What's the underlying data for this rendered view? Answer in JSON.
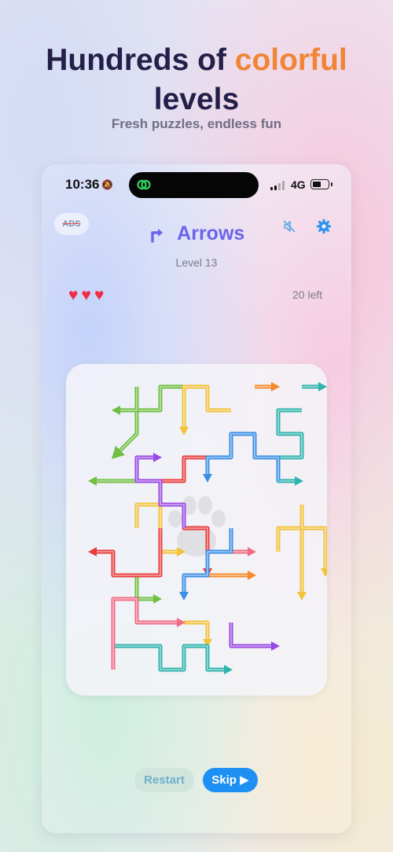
{
  "headline": {
    "pre": "Hundreds of ",
    "accent": "colorful",
    "line2": "levels"
  },
  "subtitle": "Fresh puzzles, endless fun",
  "status_bar": {
    "time": "10:36",
    "network": "4G"
  },
  "app": {
    "ads_label": "ADS",
    "title": "Arrows",
    "level": "Level 13",
    "hearts": "♥♥♥",
    "remaining": "20 left"
  },
  "actions": {
    "restart": "Restart",
    "skip": "Skip ▶"
  },
  "colors": {
    "accent": "#f08437",
    "title": "#6b63ec",
    "heart": "#ef2b46",
    "skip": "#1f90f3"
  },
  "puzzle": {
    "grid": {
      "cols": 10,
      "rows": 13
    },
    "arrows": [
      {
        "color": "#6fbf42",
        "cells": [
          [
            4,
            0
          ],
          [
            3,
            0
          ],
          [
            3,
            1
          ],
          [
            2,
            1
          ],
          [
            2,
            2
          ],
          [
            1,
            3
          ]
        ]
      },
      {
        "color": "#6fbf42",
        "cells": [
          [
            2,
            0
          ],
          [
            2,
            1
          ],
          [
            1,
            1
          ]
        ]
      },
      {
        "color": "#6fbf42",
        "cells": [
          [
            2,
            4
          ],
          [
            1,
            4
          ],
          [
            0,
            4
          ]
        ]
      },
      {
        "color": "#6fbf42",
        "cells": [
          [
            1,
            7
          ],
          [
            1,
            8
          ],
          [
            2,
            8
          ],
          [
            2,
            9
          ],
          [
            3,
            9
          ]
        ]
      },
      {
        "color": "#f2c23a",
        "cells": [
          [
            6,
            1
          ],
          [
            5,
            1
          ],
          [
            5,
            0
          ],
          [
            4,
            0
          ],
          [
            4,
            2
          ]
        ]
      },
      {
        "color": "#f2c23a",
        "cells": [
          [
            2,
            6
          ],
          [
            2,
            5
          ],
          [
            3,
            5
          ],
          [
            3,
            7
          ],
          [
            4,
            7
          ]
        ]
      },
      {
        "color": "#f2c23a",
        "cells": [
          [
            8,
            7
          ],
          [
            8,
            6
          ],
          [
            9,
            6
          ],
          [
            9,
            9
          ]
        ]
      },
      {
        "color": "#f2c23a",
        "cells": [
          [
            4,
            10
          ],
          [
            5,
            10
          ],
          [
            5,
            11
          ]
        ]
      },
      {
        "color": "#f58a2c",
        "cells": [
          [
            7,
            0
          ],
          [
            8,
            0
          ]
        ]
      },
      {
        "color": "#f58a2c",
        "cells": [
          [
            5,
            8
          ],
          [
            6,
            8
          ],
          [
            7,
            8
          ]
        ]
      },
      {
        "color": "#2fb3ad",
        "cells": [
          [
            9,
            0
          ],
          [
            10,
            0
          ]
        ]
      },
      {
        "color": "#2fb3ad",
        "cells": [
          [
            9,
            1
          ],
          [
            8,
            1
          ],
          [
            8,
            2
          ],
          [
            9,
            2
          ],
          [
            9,
            3
          ],
          [
            8,
            3
          ],
          [
            8,
            4
          ],
          [
            9,
            4
          ]
        ]
      },
      {
        "color": "#2fb3ad",
        "cells": [
          [
            1,
            12
          ],
          [
            1,
            11
          ],
          [
            3,
            11
          ],
          [
            3,
            12
          ],
          [
            4,
            12
          ],
          [
            4,
            11
          ],
          [
            5,
            11
          ],
          [
            5,
            12
          ],
          [
            6,
            12
          ]
        ]
      },
      {
        "color": "#e83d3d",
        "cells": [
          [
            3,
            6
          ],
          [
            3,
            8
          ],
          [
            1,
            8
          ],
          [
            1,
            7
          ],
          [
            0,
            7
          ]
        ]
      },
      {
        "color": "#e83d3d",
        "cells": [
          [
            5,
            3
          ],
          [
            4,
            3
          ],
          [
            4,
            4
          ],
          [
            3,
            4
          ],
          [
            3,
            5
          ],
          [
            4,
            5
          ],
          [
            4,
            6
          ],
          [
            5,
            6
          ],
          [
            5,
            8
          ]
        ]
      },
      {
        "color": "#f06b85",
        "cells": [
          [
            1,
            12
          ],
          [
            1,
            9
          ],
          [
            2,
            9
          ],
          [
            2,
            10
          ],
          [
            4,
            10
          ]
        ]
      },
      {
        "color": "#f06b85",
        "cells": [
          [
            6,
            7
          ],
          [
            7,
            7
          ]
        ]
      },
      {
        "color": "#f2c23a",
        "cells": [
          [
            9,
            5
          ],
          [
            9,
            6
          ],
          [
            10,
            6
          ],
          [
            10,
            8
          ]
        ]
      },
      {
        "color": "#9a4ae3",
        "cells": [
          [
            4,
            6
          ],
          [
            4,
            5
          ],
          [
            3,
            5
          ],
          [
            3,
            4
          ],
          [
            2,
            4
          ],
          [
            2,
            3
          ],
          [
            3,
            3
          ]
        ]
      },
      {
        "color": "#9a4ae3",
        "cells": [
          [
            6,
            10
          ],
          [
            6,
            11
          ],
          [
            8,
            11
          ]
        ]
      },
      {
        "color": "#3b8fe6",
        "cells": [
          [
            8,
            4
          ],
          [
            8,
            3
          ],
          [
            7,
            3
          ],
          [
            7,
            2
          ],
          [
            6,
            2
          ],
          [
            6,
            3
          ],
          [
            5,
            3
          ],
          [
            5,
            4
          ]
        ]
      },
      {
        "color": "#3b8fe6",
        "cells": [
          [
            6,
            6
          ],
          [
            6,
            7
          ],
          [
            5,
            7
          ],
          [
            5,
            8
          ],
          [
            4,
            8
          ],
          [
            4,
            9
          ]
        ]
      }
    ]
  }
}
